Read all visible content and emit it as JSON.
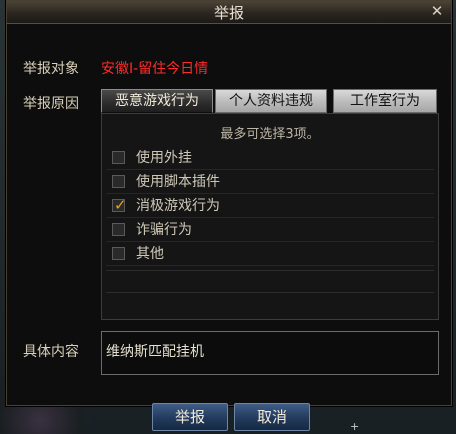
{
  "window": {
    "title": "举报",
    "close_icon": "close-icon"
  },
  "target": {
    "label": "举报对象",
    "value": "安徽I-留住今日情"
  },
  "reason": {
    "label": "举报原因",
    "tabs": [
      {
        "label": "恶意游戏行为",
        "active": true
      },
      {
        "label": "个人资料违规",
        "active": false
      },
      {
        "label": "工作室行为",
        "active": false
      }
    ],
    "hint": "最多可选择3项。",
    "options": [
      {
        "label": "使用外挂",
        "checked": false
      },
      {
        "label": "使用脚本插件",
        "checked": false
      },
      {
        "label": "消极游戏行为",
        "checked": true
      },
      {
        "label": "诈骗行为",
        "checked": false
      },
      {
        "label": "其他",
        "checked": false
      }
    ]
  },
  "detail": {
    "label": "具体内容",
    "value": "维纳斯匹配挂机"
  },
  "buttons": {
    "submit": "举报",
    "cancel": "取消"
  }
}
